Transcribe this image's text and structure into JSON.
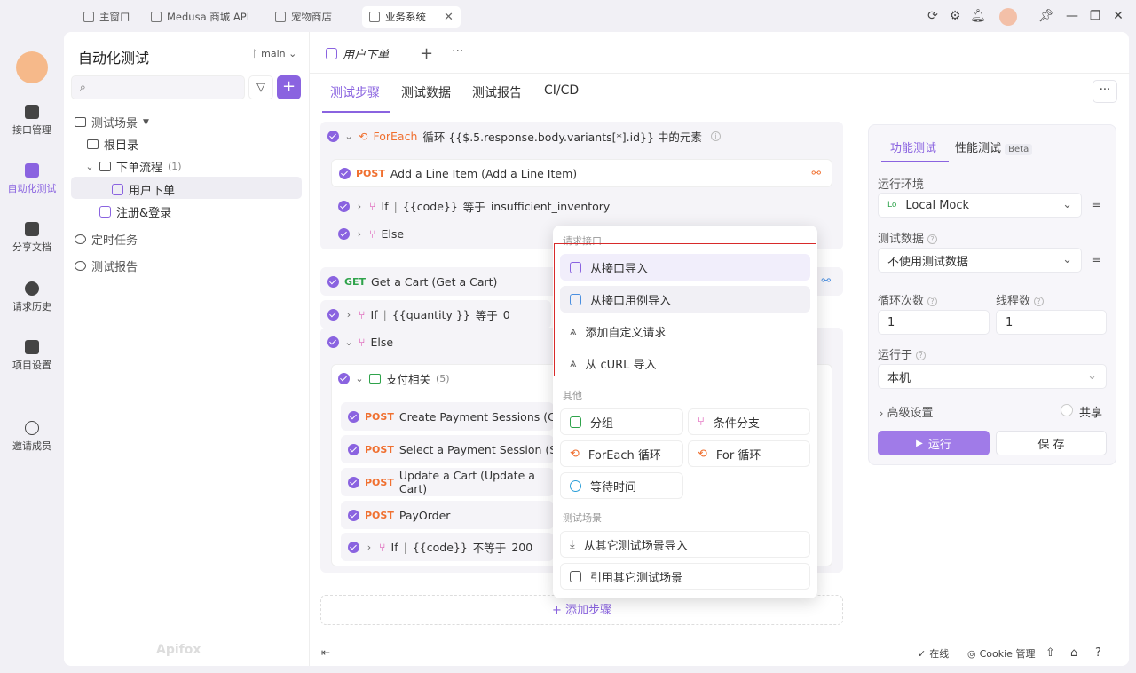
{
  "window_tabs": [
    {
      "label": "主窗口"
    },
    {
      "label": "Medusa 商城 API"
    },
    {
      "label": "宠物商店"
    },
    {
      "label": "业务系统"
    }
  ],
  "nav": [
    {
      "label": "接口管理"
    },
    {
      "label": "自动化测试"
    },
    {
      "label": "分享文档"
    },
    {
      "label": "请求历史"
    },
    {
      "label": "项目设置"
    },
    {
      "label": "邀请成员"
    }
  ],
  "tree": {
    "title": "自动化测试",
    "branch": "main",
    "section": "测试场景",
    "root": "根目录",
    "folder": "下单流程",
    "folder_count": "(1)",
    "item": "用户下单",
    "item2": "注册&登录",
    "timed": "定时任务",
    "reports": "测试报告",
    "brand": "Apifox"
  },
  "editor": {
    "tab": "用户下单",
    "subtabs": [
      "测试步骤",
      "测试数据",
      "测试报告",
      "CI/CD"
    ]
  },
  "steps": {
    "foreach_label": "ForEach",
    "foreach_desc": "循环 {{$.5.response.body.variants[*].id}} 中的元素",
    "s1_method": "POST",
    "s1_text": "Add a Line Item (Add a Line Item)",
    "if1": "If",
    "if1_var": "{{code}}",
    "if1_op": "等于",
    "if1_val": "insufficient_inventory",
    "else1": "Else",
    "s2_method": "GET",
    "s2_text": "Get a Cart (Get a Cart)",
    "if2": "If",
    "if2_var": "{{quantity }}",
    "if2_op": "等于",
    "if2_val": "0",
    "else2": "Else",
    "group": "支付相关",
    "group_count": "(5)",
    "g1_method": "POST",
    "g1_text": "Create Payment Sessions (Create P",
    "g2_method": "POST",
    "g2_text": "Select a Payment Session (Select a",
    "g3_method": "POST",
    "g3_text": "Update a Cart (Update a Cart)",
    "g4_method": "POST",
    "g4_text": "PayOrder",
    "if3": "If",
    "if3_var": "{{code}}",
    "if3_op": "不等于",
    "if3_val": "200",
    "add_step": "+ 添加步骤"
  },
  "popup": {
    "h1": "请求接口",
    "i1": "从接口导入",
    "i2": "从接口用例导入",
    "i3": "添加自定义请求",
    "i4": "从 cURL 导入",
    "h2": "其他",
    "o1": "分组",
    "o2": "条件分支",
    "o3": "ForEach 循环",
    "o4": "For 循环",
    "o5": "等待时间",
    "h3": "测试场景",
    "t1": "从其它测试场景导入",
    "t2": "引用其它测试场景"
  },
  "panel": {
    "tab1": "功能测试",
    "tab2": "性能测试",
    "beta": "Beta",
    "env_label": "运行环境",
    "env_badge": "Lo",
    "env_value": "Local Mock",
    "data_label": "测试数据",
    "data_value": "不使用测试数据",
    "loop_label": "循环次数",
    "loop_value": "1",
    "threads_label": "线程数",
    "threads_value": "1",
    "runon_label": "运行于",
    "runon_value": "本机",
    "advanced": "高级设置",
    "share": "共享",
    "run": "运行",
    "save": "保 存"
  },
  "status": {
    "online": "在线",
    "cookie": "Cookie 管理"
  }
}
